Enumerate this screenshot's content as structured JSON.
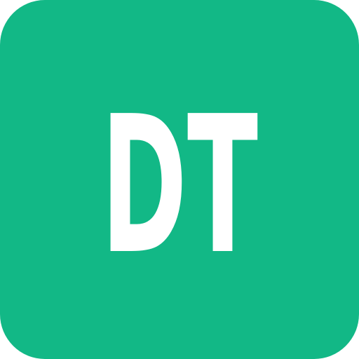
{
  "app_icon": {
    "monogram": "DT",
    "background_color": "#12b886",
    "text_color": "#ffffff"
  }
}
